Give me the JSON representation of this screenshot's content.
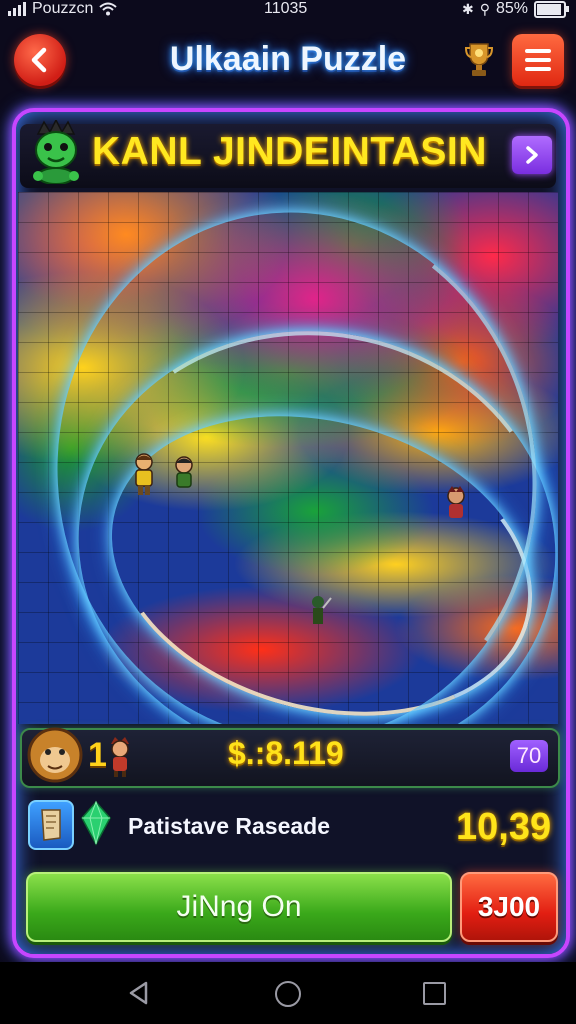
{
  "status_bar": {
    "carrier": "Pouzzcn",
    "time": "11035",
    "battery": "85%",
    "battery_level": 0.85
  },
  "header": {
    "title": "Ulkaain Puzzle",
    "back_icon": "back-arrow-icon",
    "menu_icon": "hamburger-menu-icon",
    "trophy_icon": "trophy-icon"
  },
  "banner": {
    "title": "KANL JINDEINTASIN",
    "avatar_icon": "green-goblin-avatar-icon",
    "next_icon": "chevron-right-icon"
  },
  "scorebar": {
    "level": "1",
    "score": "$.:8.119",
    "moves": "70"
  },
  "info": {
    "label": "Patistave Raseade",
    "value": "10,39",
    "tool_icon": "scroll-tool-icon",
    "gem_icon": "green-gem-icon"
  },
  "actions": {
    "play_label": "JiNng On",
    "cost_label": "3J00"
  },
  "colors": {
    "frame_accent": "#c646ff",
    "title_yellow": "#ffe820",
    "play_green": "#3aa81a",
    "cost_red": "#e21e12"
  }
}
